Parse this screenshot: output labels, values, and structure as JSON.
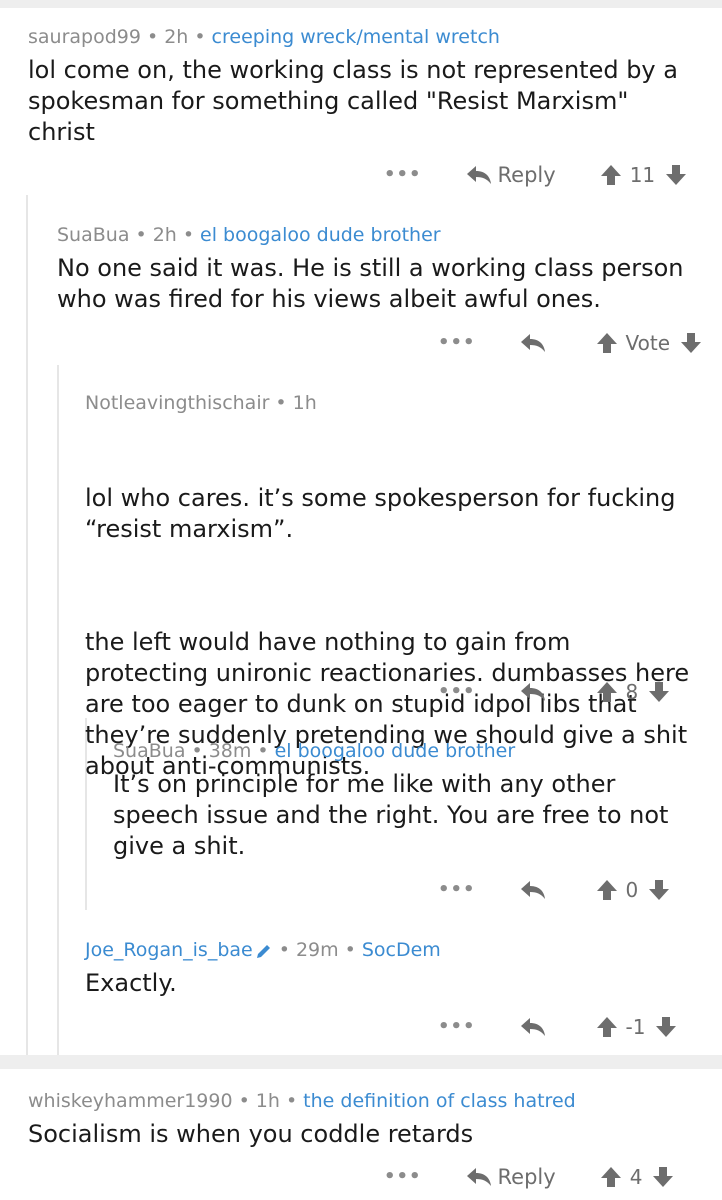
{
  "comments": [
    {
      "user": "saurapod99",
      "time": "2h",
      "flair": "creeping wreck/mental wretch",
      "body": "lol come on, the working class is not represented by a spokesman for something called \"Resist Marxism\" christ",
      "more": "•••",
      "reply_label": "Reply",
      "score": "11"
    },
    {
      "user": "SuaBua",
      "time": "2h",
      "flair": "el boogaloo dude brother",
      "body": "No one said it was. He is still a working class person who was fired for his views albeit awful ones.",
      "more": "•••",
      "vote_label": "Vote"
    },
    {
      "user": "Notleavingthischair",
      "time": "1h",
      "body_p1": "lol who cares. it’s some spokesperson for fucking “resist marxism”.",
      "body_p2": "the left would have nothing to gain from protecting unironic reactionaries. dumbasses here are too eager to dunk on stupid idpol libs that they’re suddenly pretending we should give a shit about anti-communists.",
      "more": "•••",
      "score": "8"
    },
    {
      "user": "SuaBua",
      "time": "38m",
      "flair": "el boogaloo dude brother",
      "body": "It’s on principle for me like with any other speech issue and the right. You are free to not give a shit.",
      "more": "•••",
      "score": "0"
    },
    {
      "user": "Joe_Rogan_is_bae",
      "time": "29m",
      "flair": "SocDem",
      "body": "Exactly.",
      "more": "•••",
      "score": "-1"
    },
    {
      "user": "whiskeyhammer1990",
      "time": "1h",
      "flair": "the definition of class hatred",
      "body": "Socialism is when you coddle retards",
      "more": "•••",
      "reply_label": "Reply",
      "score": "4"
    }
  ],
  "colors": {
    "flair": "#3b8bd1",
    "meta": "#8c8c8c",
    "text": "#1a1a1a",
    "icon": "#6d6d6d",
    "band": "#eeeeee"
  },
  "icons": {
    "reply": "reply-arrow-icon",
    "up": "upvote-arrow-icon",
    "down": "downvote-arrow-icon",
    "edit": "pencil-icon"
  }
}
